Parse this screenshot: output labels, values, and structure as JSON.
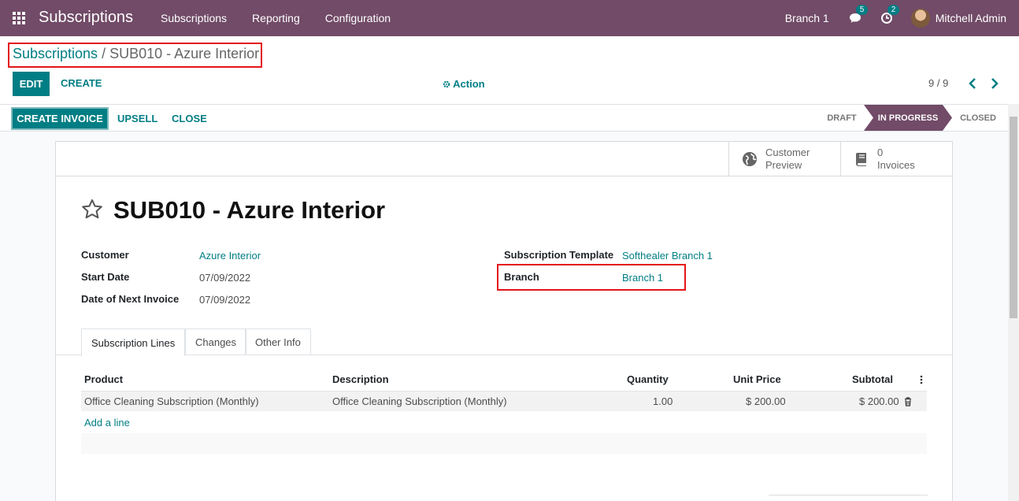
{
  "navbar": {
    "brand": "Subscriptions",
    "menu": [
      "Subscriptions",
      "Reporting",
      "Configuration"
    ],
    "branch": "Branch 1",
    "messages_count": "5",
    "activities_count": "2",
    "user_name": "Mitchell Admin"
  },
  "breadcrumb": {
    "parent": "Subscriptions",
    "separator": " / ",
    "current": "SUB010 - Azure Interior"
  },
  "control": {
    "edit_label": "EDIT",
    "create_label": "CREATE",
    "action_label": "Action",
    "pager": "9 / 9"
  },
  "statusbar": {
    "create_invoice_label": "CREATE INVOICE",
    "upsell_label": "UPSELL",
    "close_label": "CLOSE",
    "stages": [
      "DRAFT",
      "IN PROGRESS",
      "CLOSED"
    ],
    "active_stage": "IN PROGRESS"
  },
  "smart_buttons": {
    "preview_line1": "Customer",
    "preview_line2": "Preview",
    "invoices_count": "0",
    "invoices_label": "Invoices"
  },
  "record": {
    "title": "SUB010 - Azure Interior",
    "fields": {
      "customer_label": "Customer",
      "customer_value": "Azure Interior",
      "start_date_label": "Start Date",
      "start_date_value": "07/09/2022",
      "next_invoice_label": "Date of Next Invoice",
      "next_invoice_value": "07/09/2022",
      "template_label": "Subscription Template",
      "template_value": "Softhealer Branch 1",
      "branch_label": "Branch",
      "branch_value": "Branch 1"
    }
  },
  "tabs": [
    "Subscription Lines",
    "Changes",
    "Other Info"
  ],
  "lines": {
    "headers": [
      "Product",
      "Description",
      "Quantity",
      "Unit Price",
      "Subtotal"
    ],
    "rows": [
      {
        "product": "Office Cleaning Subscription (Monthly)",
        "description": "Office Cleaning Subscription (Monthly)",
        "quantity": "1.00",
        "unit_price": "$ 200.00",
        "subtotal": "$ 200.00"
      }
    ],
    "add_line_label": "Add a line"
  },
  "colors": {
    "navbar": "#714b67",
    "accent": "#017e84",
    "highlight_box": "#e3151a"
  }
}
